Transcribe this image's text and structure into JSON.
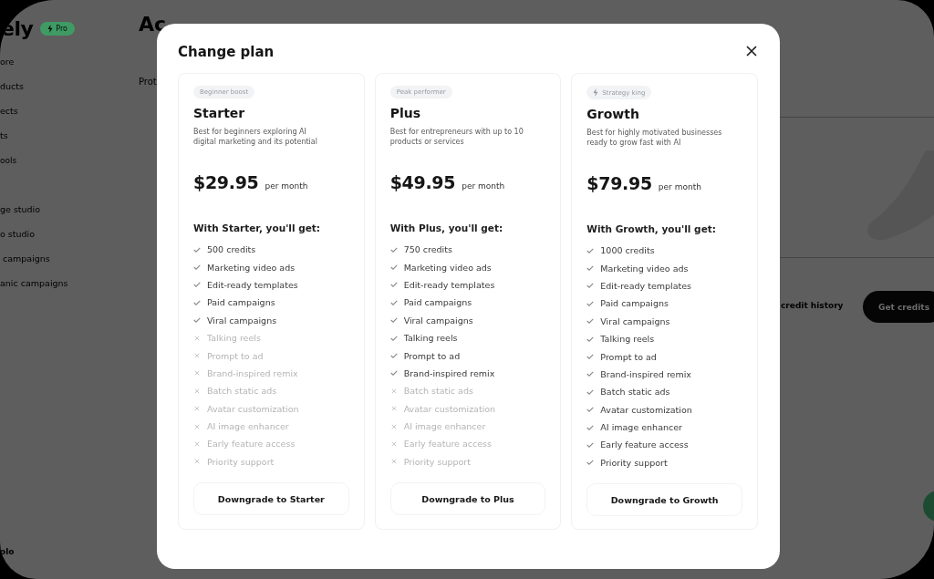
{
  "background": {
    "logo": "ely",
    "badge": "Pro",
    "sidebar": [
      {
        "label": "ore",
        "kind": "item"
      },
      {
        "label": "ducts",
        "kind": "item"
      },
      {
        "label": "ects",
        "kind": "item"
      },
      {
        "label": "ts",
        "kind": "item"
      },
      {
        "label": "ools",
        "kind": "section"
      },
      {
        "label": "ge studio",
        "kind": "item"
      },
      {
        "label": "o studio",
        "kind": "item"
      },
      {
        "label": " campaigns",
        "kind": "item"
      },
      {
        "label": "anic campaigns",
        "kind": "item"
      }
    ],
    "account": "olo",
    "heading": "Ac",
    "tab": "Prot",
    "link": "credit history",
    "button": "Get credits"
  },
  "modal": {
    "title": "Change plan",
    "plans": [
      {
        "badge": "Beginner boost",
        "badge_icon": false,
        "name": "Starter",
        "description": "Best for beginners exploring AI digital marketing and its potential",
        "price": "$29.95",
        "period": "per month",
        "features_title": "With Starter, you'll get:",
        "features": [
          {
            "label": "500 credits",
            "included": true
          },
          {
            "label": "Marketing video ads",
            "included": true
          },
          {
            "label": "Edit-ready templates",
            "included": true
          },
          {
            "label": "Paid campaigns",
            "included": true
          },
          {
            "label": "Viral campaigns",
            "included": true
          },
          {
            "label": "Talking reels",
            "included": false
          },
          {
            "label": "Prompt to ad",
            "included": false
          },
          {
            "label": "Brand-inspired remix",
            "included": false
          },
          {
            "label": "Batch static ads",
            "included": false
          },
          {
            "label": "Avatar customization",
            "included": false
          },
          {
            "label": "AI image enhancer",
            "included": false
          },
          {
            "label": "Early feature access",
            "included": false
          },
          {
            "label": "Priority support",
            "included": false
          }
        ],
        "button": "Downgrade to Starter"
      },
      {
        "badge": "Peak performer",
        "badge_icon": false,
        "name": "Plus",
        "description": "Best for entrepreneurs with up to 10 products or services",
        "price": "$49.95",
        "period": "per month",
        "features_title": "With Plus, you'll get:",
        "features": [
          {
            "label": "750 credits",
            "included": true
          },
          {
            "label": "Marketing video ads",
            "included": true
          },
          {
            "label": "Edit-ready templates",
            "included": true
          },
          {
            "label": "Paid campaigns",
            "included": true
          },
          {
            "label": "Viral campaigns",
            "included": true
          },
          {
            "label": "Talking reels",
            "included": true
          },
          {
            "label": "Prompt to ad",
            "included": true
          },
          {
            "label": "Brand-inspired remix",
            "included": true
          },
          {
            "label": "Batch static ads",
            "included": false
          },
          {
            "label": "Avatar customization",
            "included": false
          },
          {
            "label": "AI image enhancer",
            "included": false
          },
          {
            "label": "Early feature access",
            "included": false
          },
          {
            "label": "Priority support",
            "included": false
          }
        ],
        "button": "Downgrade to Plus"
      },
      {
        "badge": "Strategy king",
        "badge_icon": true,
        "name": "Growth",
        "description": "Best for highly motivated businesses ready to grow fast with AI",
        "price": "$79.95",
        "period": "per month",
        "features_title": "With Growth, you'll get:",
        "features": [
          {
            "label": "1000 credits",
            "included": true
          },
          {
            "label": "Marketing video ads",
            "included": true
          },
          {
            "label": "Edit-ready templates",
            "included": true
          },
          {
            "label": "Paid campaigns",
            "included": true
          },
          {
            "label": "Viral campaigns",
            "included": true
          },
          {
            "label": "Talking reels",
            "included": true
          },
          {
            "label": "Prompt to ad",
            "included": true
          },
          {
            "label": "Brand-inspired remix",
            "included": true
          },
          {
            "label": "Batch static ads",
            "included": true
          },
          {
            "label": "Avatar customization",
            "included": true
          },
          {
            "label": "AI image enhancer",
            "included": true
          },
          {
            "label": "Early feature access",
            "included": true
          },
          {
            "label": "Priority support",
            "included": true
          }
        ],
        "button": "Downgrade to Growth"
      }
    ]
  }
}
